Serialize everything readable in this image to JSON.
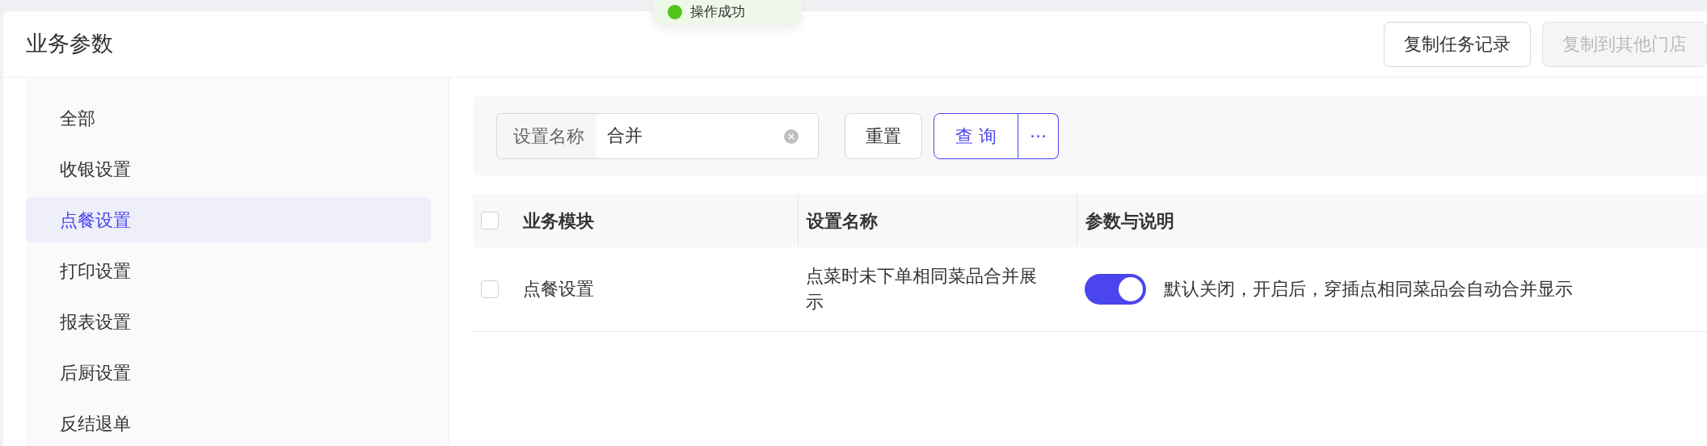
{
  "toast": {
    "text": "操作成功",
    "kind": "success"
  },
  "header": {
    "title": "业务参数",
    "buttons": [
      {
        "label": "复制任务记录",
        "disabled": false
      },
      {
        "label": "复制到其他门店",
        "disabled": true
      }
    ]
  },
  "sidebar": {
    "items": [
      {
        "label": "全部",
        "selected": false
      },
      {
        "label": "收银设置",
        "selected": false
      },
      {
        "label": "点餐设置",
        "selected": true
      },
      {
        "label": "打印设置",
        "selected": false
      },
      {
        "label": "报表设置",
        "selected": false
      },
      {
        "label": "后厨设置",
        "selected": false
      },
      {
        "label": "反结退单",
        "selected": false
      }
    ]
  },
  "filter": {
    "label": "设置名称",
    "value": "合并",
    "buttons": [
      {
        "label": "重置",
        "kind": "default"
      },
      {
        "label": "查 询",
        "kind": "primary"
      },
      {
        "label": "···",
        "kind": "more"
      }
    ]
  },
  "table": {
    "select_all_checked": false,
    "columns": [
      "业务模块",
      "设置名称",
      "参数与说明"
    ],
    "rows": [
      {
        "checked": false,
        "module": "点餐设置",
        "name": "点菜时未下单相同菜品合并展示",
        "on": true,
        "description": "默认关闭，开启后，穿插点相同菜品会自动合并显示"
      }
    ]
  }
}
